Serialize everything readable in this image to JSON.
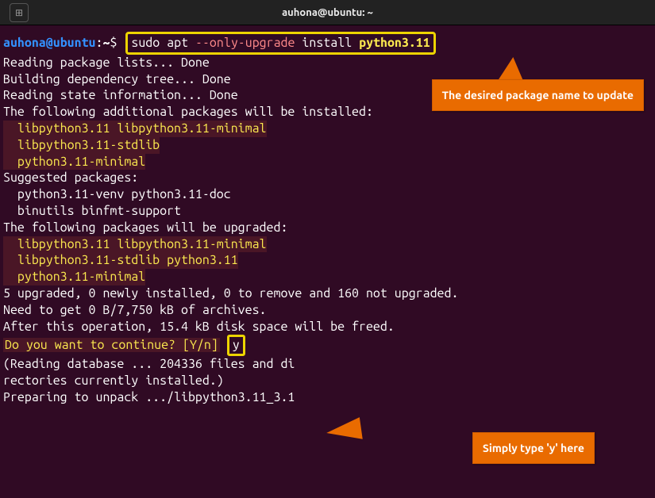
{
  "titlebar": {
    "title": "auhona@ubuntu: ~"
  },
  "prompt": {
    "user": "auhona",
    "host": "ubuntu",
    "path": "~",
    "symbol": "$"
  },
  "command": {
    "sudo": "sudo apt ",
    "flag": "--only-upgrade",
    "install": " install ",
    "pkg": "python3.11"
  },
  "output": {
    "reading_lists": "Reading package lists... Done",
    "building_tree": "Building dependency tree... Done",
    "reading_state": "Reading state information... Done",
    "additional_header": "The following additional packages will be installed:",
    "additional_pkgs_l1": "  libpython3.11 libpython3.11-minimal",
    "additional_pkgs_l2": "  libpython3.11-stdlib",
    "additional_pkgs_l3": "  python3.11-minimal",
    "suggested_header": "Suggested packages:",
    "suggested_l1": "  python3.11-venv python3.11-doc",
    "suggested_l2": "  binutils binfmt-support",
    "upgraded_header": "The following packages will be upgraded:",
    "upgraded_l1": "  libpython3.11 libpython3.11-minimal",
    "upgraded_l2": "  libpython3.11-stdlib python3.11",
    "upgraded_l3": "  python3.11-minimal",
    "summary": "5 upgraded, 0 newly installed, 0 to remove and 160 not upgraded.",
    "need_get": "Need to get 0 B/7,750 kB of archives.",
    "after_op": "After this operation, 15.4 kB disk space will be freed.",
    "continue_q": "Do you want to continue? [Y/n]",
    "continue_a": "y",
    "reading_db": "(Reading database ... 204336 files and di",
    "reading_db2": "rectories currently installed.)",
    "preparing": "Preparing to unpack .../libpython3.11_3.1"
  },
  "callouts": {
    "c1": "The desired package name to update",
    "c2": "Simply type 'y' here"
  }
}
